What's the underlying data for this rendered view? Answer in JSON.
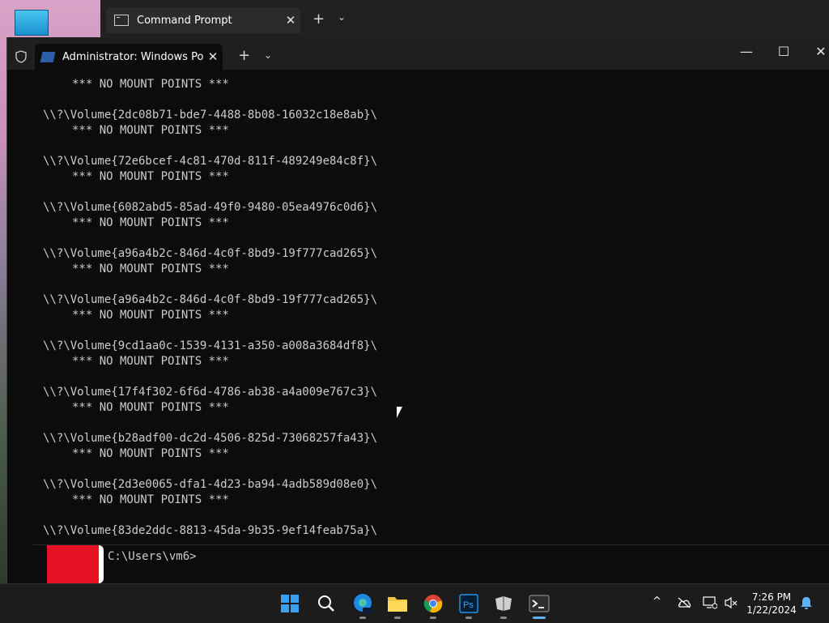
{
  "background_window": {
    "tab_title": "Command Prompt",
    "close": "✕",
    "new_tab": "+",
    "dropdown": "⌄"
  },
  "window": {
    "tab_title": "Administrator: Windows Powe",
    "close": "✕",
    "new_tab": "+",
    "dropdown": "⌄",
    "minimize": "—",
    "maximize": "☐",
    "window_close": "✕"
  },
  "terminal": {
    "lines": [
      "*** NO MOUNT POINTS ***",
      "\\\\?\\Volume{2dc08b71-bde7-4488-8b08-16032c18e8ab}\\",
      "*** NO MOUNT POINTS ***",
      "\\\\?\\Volume{72e6bcef-4c81-470d-811f-489249e84c8f}\\",
      "*** NO MOUNT POINTS ***",
      "\\\\?\\Volume{6082abd5-85ad-49f0-9480-05ea4976c0d6}\\",
      "*** NO MOUNT POINTS ***",
      "\\\\?\\Volume{a96a4b2c-846d-4c0f-8bd9-19f777cad265}\\",
      "*** NO MOUNT POINTS ***",
      "\\\\?\\Volume{a96a4b2c-846d-4c0f-8bd9-19f777cad265}\\",
      "*** NO MOUNT POINTS ***",
      "\\\\?\\Volume{9cd1aa0c-1539-4131-a350-a008a3684df8}\\",
      "*** NO MOUNT POINTS ***",
      "\\\\?\\Volume{17f4f302-6f6d-4786-ab38-a4a009e767c3}\\",
      "*** NO MOUNT POINTS ***",
      "\\\\?\\Volume{b28adf00-dc2d-4506-825d-73068257fa43}\\",
      "*** NO MOUNT POINTS ***",
      "\\\\?\\Volume{2d3e0065-dfa1-4d23-ba94-4adb589d08e0}\\",
      "*** NO MOUNT POINTS ***",
      "\\\\?\\Volume{83de2ddc-8813-45da-9b35-9ef14feab75a}\\"
    ]
  },
  "prompt": {
    "text": "C:\\Users\\vm6>"
  },
  "taskbar": {
    "pinned": [
      "start-icon",
      "search-icon",
      "edge-beta-icon",
      "file-explorer-icon",
      "chrome-icon",
      "photoshop-icon",
      "app-icon",
      "terminal-icon"
    ],
    "clock_time": "7:26 PM",
    "clock_date": "1/22/2024",
    "tray_chevron": "^"
  },
  "colors": {
    "terminal_bg": "#0c0c0c",
    "terminal_fg": "#cccccc",
    "accent_red": "#e81123"
  }
}
